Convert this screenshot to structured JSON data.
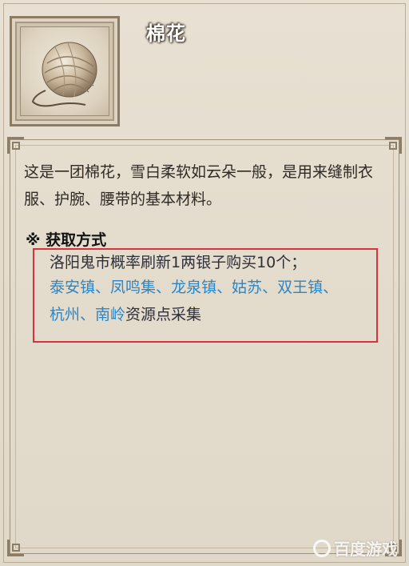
{
  "item": {
    "name": "棉花",
    "icon": "cotton-ball-icon",
    "description": "这是一团棉花，雪白柔软如云朵一般，是用来缝制衣服、护腕、腰带的基本材料。"
  },
  "acquisition": {
    "heading": "※ 获取方式",
    "line1": "洛阳鬼市概率刷新1两银子购买10个；",
    "locations": [
      "泰安镇",
      "凤鸣集",
      "龙泉镇",
      "姑苏",
      "双王镇",
      "杭州",
      "南岭"
    ],
    "separator": "、",
    "suffix": "资源点采集"
  },
  "watermark": "百度游戏",
  "colors": {
    "location_text": "#2a86c6",
    "highlight_border": "#d8323a",
    "title_text": "#ffffff"
  }
}
